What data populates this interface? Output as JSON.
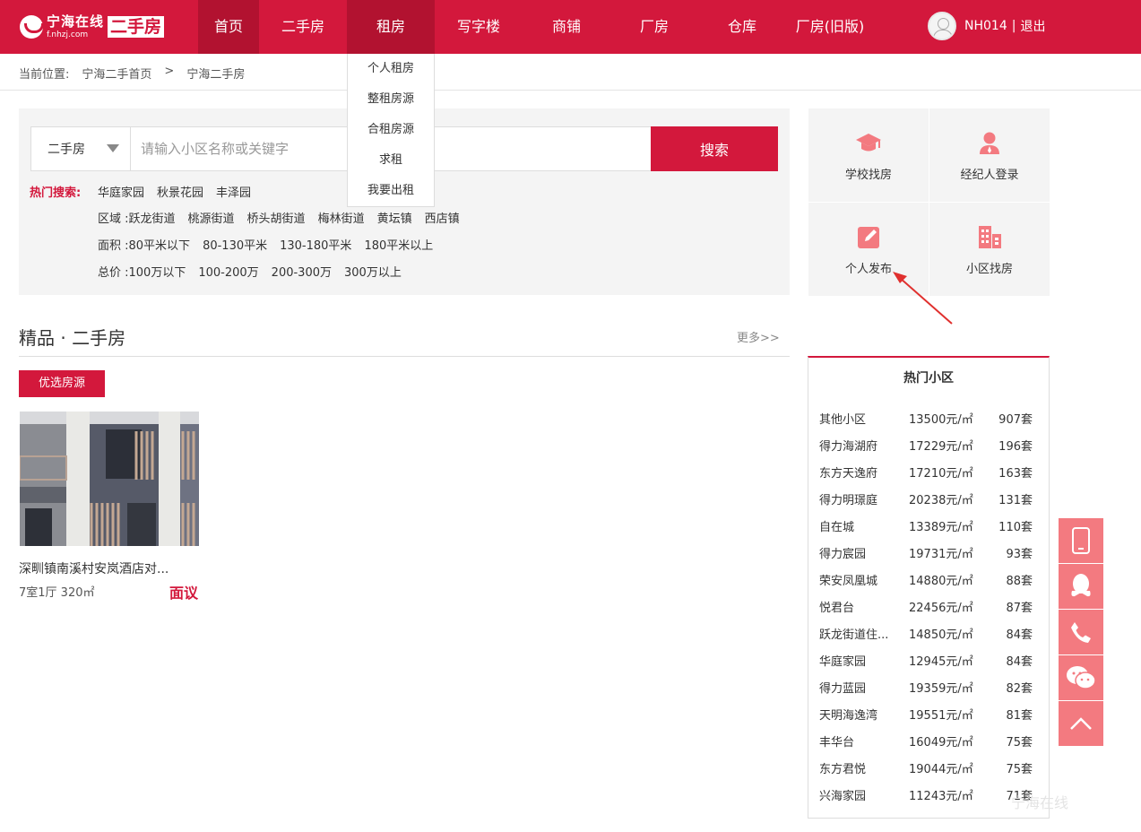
{
  "header": {
    "logo_name": "宁海在线",
    "logo_domain": "f.nhzj.com",
    "logo_badge": "二手房",
    "nav": [
      {
        "label": "首页"
      },
      {
        "label": "二手房"
      },
      {
        "label": "租房"
      },
      {
        "label": "写字楼"
      },
      {
        "label": "商铺"
      },
      {
        "label": "厂房"
      },
      {
        "label": "仓库"
      },
      {
        "label": "厂房(旧版)"
      }
    ],
    "user": {
      "name": "NH014",
      "sep": "|",
      "logout": "退出"
    }
  },
  "dropdown": [
    "个人租房",
    "整租房源",
    "合租房源",
    "求租",
    "我要出租"
  ],
  "breadcrumb": {
    "label": "当前位置:",
    "items": [
      "宁海二手首页",
      ">",
      "宁海二手房"
    ]
  },
  "search": {
    "type": "二手房",
    "placeholder": "请输入小区名称或关键字",
    "button": "搜索",
    "hot_label": "热门搜索:",
    "hot": [
      "华庭家园",
      "秋景花园",
      "丰泽园"
    ],
    "filters": [
      {
        "label": "区域 : ",
        "items": [
          "跃龙街道",
          "桃源街道",
          "桥头胡街道",
          "梅林街道",
          "黄坛镇",
          "西店镇"
        ]
      },
      {
        "label": "面积 : ",
        "items": [
          "80平米以下",
          "80-130平米",
          "130-180平米",
          "180平米以上"
        ]
      },
      {
        "label": "总价 : ",
        "items": [
          "100万以下",
          "100-200万",
          "200-300万",
          "300万以上"
        ]
      }
    ]
  },
  "section": {
    "title": "精品 · 二手房",
    "more": "更多>>",
    "tag": "优选房源"
  },
  "listing": {
    "title": "深甽镇南溪村安岚酒店对...",
    "meta": "7室1厅   320㎡",
    "price": "面议"
  },
  "quick": [
    {
      "label": "学校找房",
      "icon": "graduation-cap-icon"
    },
    {
      "label": "经纪人登录",
      "icon": "agent-icon"
    },
    {
      "label": "个人发布",
      "icon": "edit-icon"
    },
    {
      "label": "小区找房",
      "icon": "building-icon"
    }
  ],
  "hot_communities": {
    "title": "热门小区",
    "rows": [
      [
        "其他小区",
        "13500元/㎡",
        "907套"
      ],
      [
        "得力海湖府",
        "17229元/㎡",
        "196套"
      ],
      [
        "东方天逸府",
        "17210元/㎡",
        "163套"
      ],
      [
        "得力明璟庭",
        "20238元/㎡",
        "131套"
      ],
      [
        "自在城",
        "13389元/㎡",
        "110套"
      ],
      [
        "得力宸园",
        "19731元/㎡",
        "93套"
      ],
      [
        "荣安凤凰城",
        "14880元/㎡",
        "88套"
      ],
      [
        "悦君台",
        "22456元/㎡",
        "87套"
      ],
      [
        "跃龙街道住...",
        "14850元/㎡",
        "84套"
      ],
      [
        "华庭家园",
        "12945元/㎡",
        "84套"
      ],
      [
        "得力蓝园",
        "19359元/㎡",
        "82套"
      ],
      [
        "天明海逸湾",
        "19551元/㎡",
        "81套"
      ],
      [
        "丰华台",
        "16049元/㎡",
        "75套"
      ],
      [
        "东方君悦",
        "19044元/㎡",
        "75套"
      ],
      [
        "兴海家园",
        "11243元/㎡",
        "71套"
      ]
    ]
  },
  "float_bar": [
    "phone-mobile-icon",
    "qq-icon",
    "phone-icon",
    "wechat-icon",
    "back-to-top-icon"
  ],
  "watermark": "宁海在线",
  "colors": {
    "brand": "#d3183c",
    "brand_dark": "#b21230",
    "float": "#f37a80",
    "icon": "#f37a80"
  }
}
